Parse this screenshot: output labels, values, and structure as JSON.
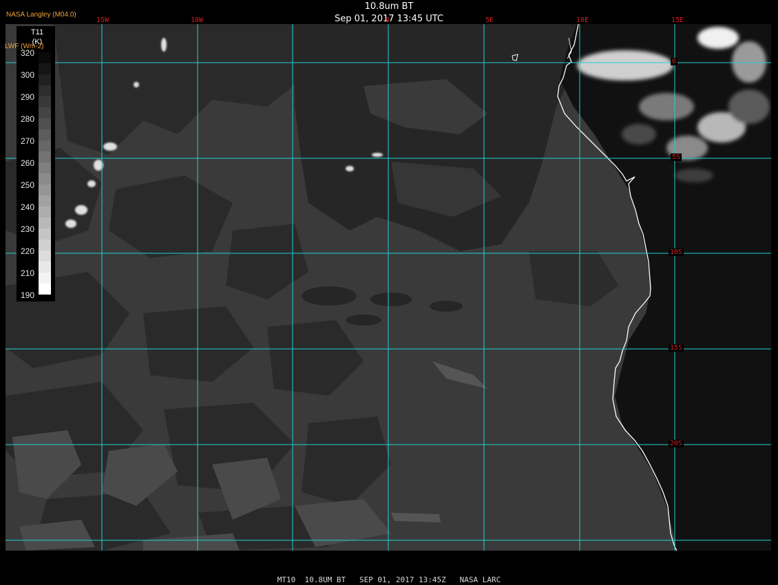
{
  "header": {
    "title": "10.8um BT",
    "datetime": "Sep 01, 2017 13:45 UTC",
    "provider": "NASA Langley (M04.0)",
    "unit_overlay": "LWF (Wm-2)"
  },
  "legend": {
    "title": "T11",
    "unit": "(K)",
    "ticks": [
      "320",
      "300",
      "290",
      "280",
      "270",
      "260",
      "250",
      "240",
      "230",
      "220",
      "210",
      "190"
    ],
    "gradient_dark": "#0a0a0a",
    "gradient_light": "#ffffff"
  },
  "map": {
    "longitude_labels": [
      "15W",
      "10W",
      "0",
      "5E",
      "10E",
      "15E"
    ],
    "latitude_labels": [
      "0",
      "5S",
      "10S",
      "15S",
      "20S"
    ],
    "grid_color": "#22d3d3",
    "label_color": "#d42020",
    "coast_color": "#ffffff",
    "ocean_color": "#3a3a3a",
    "land_color": "#0f0f0f"
  },
  "footer": {
    "text": "MT10  10.8UM BT   SEP 01, 2017 13:45Z   NASA LARC"
  }
}
